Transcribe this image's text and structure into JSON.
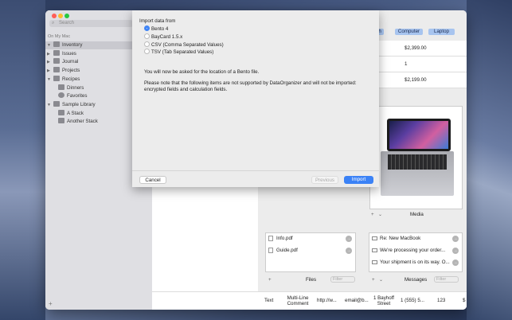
{
  "sidebar": {
    "search_placeholder": "Search",
    "section_title": "On My Mac",
    "items": [
      {
        "label": "Inventory",
        "disclosure": "▼"
      },
      {
        "label": "Issues",
        "disclosure": "▶"
      },
      {
        "label": "Journal",
        "disclosure": "▶"
      },
      {
        "label": "Projects",
        "disclosure": "▶"
      },
      {
        "label": "Recipes",
        "disclosure": "▼"
      },
      {
        "label": "Dinners",
        "disclosure": ""
      },
      {
        "label": "Favorites",
        "disclosure": ""
      },
      {
        "label": "Sample Library",
        "disclosure": "▼"
      },
      {
        "label": "A Stack",
        "disclosure": ""
      },
      {
        "label": "Another Stack",
        "disclosure": ""
      }
    ],
    "add_glyph": "+"
  },
  "tabs": [
    "ch",
    "Computer",
    "Laptop"
  ],
  "rows": [
    "$2,399.00",
    "1",
    "$2,199.00"
  ],
  "media": {
    "label": "Media",
    "add": "+",
    "chevron": "⌄"
  },
  "files": {
    "items": [
      "Info.pdf",
      "Guide.pdf"
    ],
    "label": "Files",
    "add": "+",
    "filter_placeholder": "Filter",
    "arrow": "→"
  },
  "messages": {
    "items": [
      "Re: New MacBook",
      "We're processing your order...",
      "Your shipment is on its way. O..."
    ],
    "label": "Messages",
    "add": "+",
    "chevron": "⌄",
    "filter_placeholder": "Filter",
    "arrow": "→"
  },
  "bottom_cells": [
    "Text",
    "Multi-Line Comment",
    "http://w...",
    "email@b...",
    "1 Bayhoff Street",
    "1 (555) 5...",
    "123",
    "$"
  ],
  "dialog": {
    "title": "Import data from",
    "options": [
      {
        "label": "Bento 4",
        "selected": true
      },
      {
        "label": "BayCard 1.5.x",
        "selected": false
      },
      {
        "label": "CSV (Comma Separated Values)",
        "selected": false
      },
      {
        "label": "TSV (Tab Separated Values)",
        "selected": false
      }
    ],
    "message1": "You will now be asked for the location of a Bento file.",
    "message2": "Please note that the following items are not supported by DataOrganizer and will not be imported:",
    "message3": "encrypted fields and calculation fields.",
    "cancel": "Cancel",
    "previous": "Previous",
    "import": "Import"
  },
  "colors": {
    "accent": "#3b82f6",
    "tab": "#a7c4ef",
    "close": "#ff5f57",
    "minimize": "#febc2e",
    "zoom": "#28c840"
  }
}
